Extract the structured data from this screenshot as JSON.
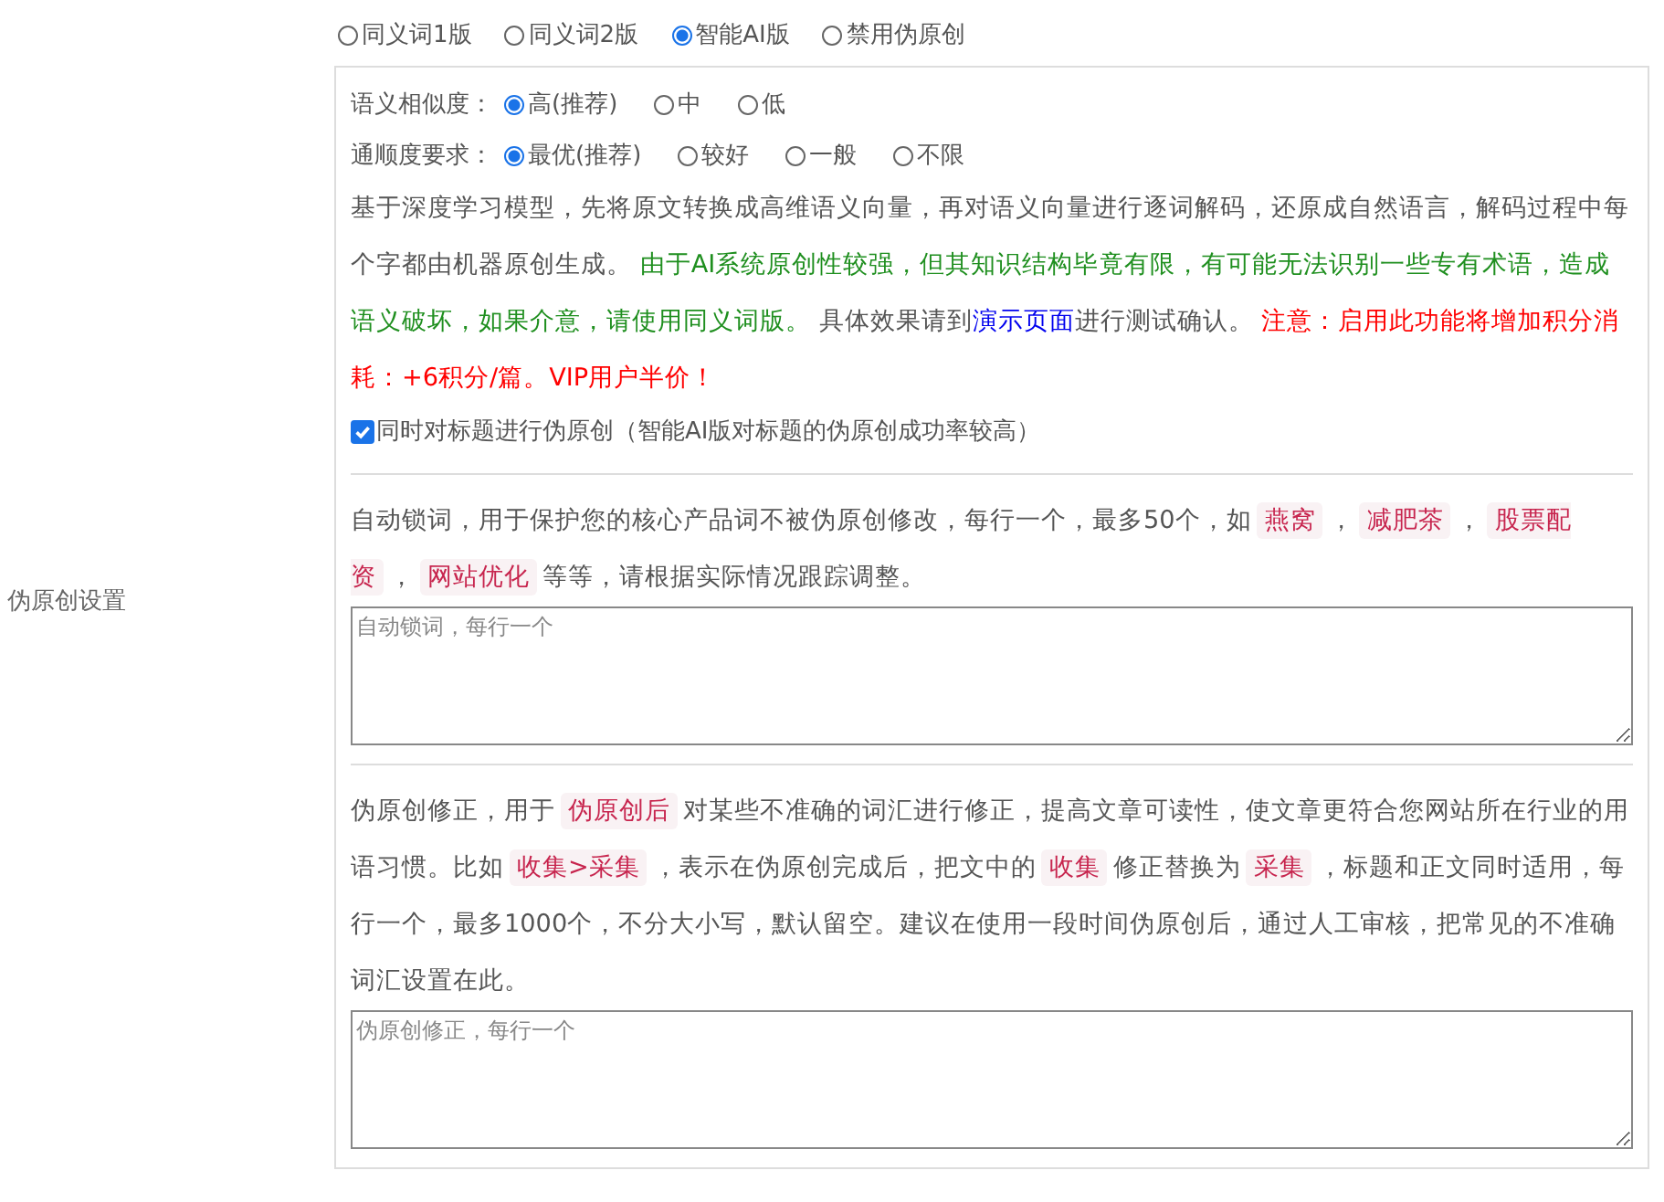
{
  "mode_options": [
    {
      "label": "同义词1版",
      "selected": false
    },
    {
      "label": "同义词2版",
      "selected": false
    },
    {
      "label": "智能AI版",
      "selected": true
    },
    {
      "label": "禁用伪原创",
      "selected": false
    }
  ],
  "section_label": "伪原创设置",
  "similarity": {
    "label": "语义相似度：",
    "options": [
      {
        "label": "高(推荐)",
        "selected": true
      },
      {
        "label": "中",
        "selected": false
      },
      {
        "label": "低",
        "selected": false
      }
    ]
  },
  "fluency": {
    "label": "通顺度要求：",
    "options": [
      {
        "label": "最优(推荐)",
        "selected": true
      },
      {
        "label": "较好",
        "selected": false
      },
      {
        "label": "一般",
        "selected": false
      },
      {
        "label": "不限",
        "selected": false
      }
    ]
  },
  "ai_description": [
    {
      "kind": "plain",
      "text": "基于深度学习模型，先将原文转换成高维语义向量，再对语义向量进行逐词解码，还原成自然语言，解码过程中每个字都由机器原创生成。 "
    },
    {
      "kind": "green",
      "text": "由于AI系统原创性较强，但其知识结构毕竟有限，有可能无法识别一些专有术语，造成语义破坏，如果介意，请使用同义词版。"
    },
    {
      "kind": "plain",
      "text": " 具体效果请到"
    },
    {
      "kind": "link",
      "text": "演示页面"
    },
    {
      "kind": "plain",
      "text": "进行测试确认。 "
    },
    {
      "kind": "red",
      "text": "注意：启用此功能将增加积分消耗：+6积分/篇。VIP用户半价！"
    }
  ],
  "title_option": {
    "label": "同时对标题进行伪原创（智能AI版对标题的伪原创成功率较高）",
    "checked": true
  },
  "lock_words": {
    "description": [
      {
        "kind": "plain",
        "text": "自动锁词，用于保护您的核心产品词不被伪原创修改，每行一个，最多50个，如"
      },
      {
        "kind": "tag",
        "text": "燕窝"
      },
      {
        "kind": "plain",
        "text": "，"
      },
      {
        "kind": "tag",
        "text": "减肥茶"
      },
      {
        "kind": "plain",
        "text": "，"
      },
      {
        "kind": "tag",
        "text": "股票配资"
      },
      {
        "kind": "plain",
        "text": "，"
      },
      {
        "kind": "tag",
        "text": "网站优化"
      },
      {
        "kind": "plain",
        "text": "等等，请根据实际情况跟踪调整。"
      }
    ],
    "placeholder": "自动锁词，每行一个"
  },
  "corrections": {
    "description": [
      {
        "kind": "plain",
        "text": "伪原创修正，用于"
      },
      {
        "kind": "tag",
        "text": "伪原创后"
      },
      {
        "kind": "plain",
        "text": "对某些不准确的词汇进行修正，提高文章可读性，使文章更符合您网站所在行业的用语习惯。比如"
      },
      {
        "kind": "tag",
        "text": "收集>采集"
      },
      {
        "kind": "plain",
        "text": "，表示在伪原创完成后，把文中的"
      },
      {
        "kind": "tag",
        "text": "收集"
      },
      {
        "kind": "plain",
        "text": "修正替换为"
      },
      {
        "kind": "tag",
        "text": "采集"
      },
      {
        "kind": "plain",
        "text": "，标题和正文同时适用，每行一个，最多1000个，不分大小写，默认留空。建议在使用一段时间伪原创后，通过人工审核，把常见的不准确词汇设置在此。"
      }
    ],
    "placeholder": "伪原创修正，每行一个"
  }
}
